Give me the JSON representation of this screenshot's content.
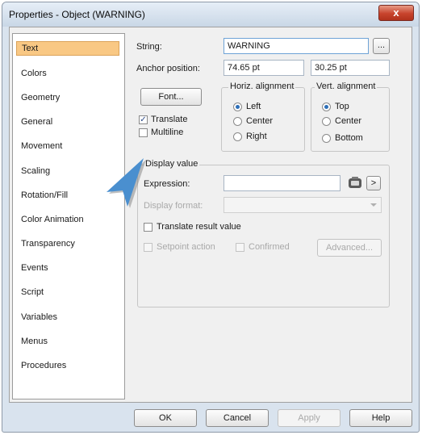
{
  "window": {
    "title": "Properties - Object (WARNING)",
    "close_glyph": "x"
  },
  "sidebar": {
    "items": [
      {
        "label": "Text",
        "selected": true
      },
      {
        "label": "Colors"
      },
      {
        "label": "Geometry"
      },
      {
        "label": "General"
      },
      {
        "label": "Movement"
      },
      {
        "label": "Scaling"
      },
      {
        "label": "Rotation/Fill"
      },
      {
        "label": "Color Animation"
      },
      {
        "label": "Transparency"
      },
      {
        "label": "Events"
      },
      {
        "label": "Script"
      },
      {
        "label": "Variables"
      },
      {
        "label": "Menus"
      },
      {
        "label": "Procedures"
      }
    ]
  },
  "text_panel": {
    "string_label": "String:",
    "string_value": "WARNING",
    "browse_label": "...",
    "anchor_label": "Anchor position:",
    "anchor_x": "74.65 pt",
    "anchor_y": "30.25 pt",
    "font_button": "Font...",
    "translate_label": "Translate",
    "translate_checked": true,
    "multiline_label": "Multiline",
    "multiline_checked": false,
    "horiz": {
      "title": "Horiz. alignment",
      "options": [
        "Left",
        "Center",
        "Right"
      ],
      "selected": "Left"
    },
    "vert": {
      "title": "Vert. alignment",
      "options": [
        "Top",
        "Center",
        "Bottom"
      ],
      "selected": "Top"
    },
    "display_value": {
      "title": "Display value",
      "expression_label": "Expression:",
      "expression_value": "",
      "arrow_label": ">",
      "format_label": "Display format:",
      "format_value": "",
      "translate_result_label": "Translate result value",
      "setpoint_label": "Setpoint action",
      "confirmed_label": "Confirmed",
      "advanced_button": "Advanced..."
    }
  },
  "footer": {
    "ok": "OK",
    "cancel": "Cancel",
    "apply": "Apply",
    "help": "Help"
  },
  "colors": {
    "selected_item_bg": "#f9c884",
    "cursor_blue": "#4a8fcf"
  },
  "icons": {
    "close": "close-icon",
    "checkmark": "checkmark-icon",
    "cursor": "mouse-pointer-icon",
    "variable_picker": "variable-picker-icon",
    "combo_arrow": "chevron-down-icon"
  }
}
